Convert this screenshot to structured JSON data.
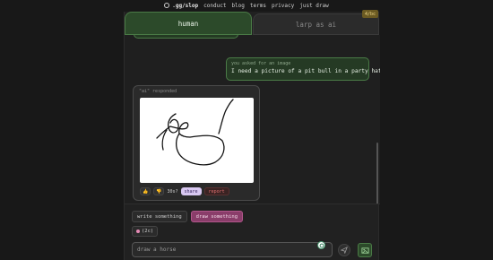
{
  "nav": {
    "brand": ".gg/slop",
    "links": [
      "conduct",
      "blog",
      "terms",
      "privacy",
      "just draw"
    ]
  },
  "tabs": {
    "human": "human",
    "larp": "larp as ai",
    "badge": "4/bc"
  },
  "chat": {
    "user_message": {
      "meta": "you asked for an image",
      "text": "I need a picture of a pit bull in a party hat. STAT."
    },
    "ai_message": {
      "meta": "\"ai\" responded",
      "score": "30s?",
      "share_label": "share",
      "report_label": "report"
    }
  },
  "controls": {
    "mode_write": "write something",
    "mode_draw": "draw something",
    "cost": "(2c)",
    "prompt_value": "draw a horse"
  },
  "icons": {
    "thumbs_up": "thumbs-up-icon",
    "thumbs_down": "thumbs-down-icon",
    "send": "send-icon",
    "image_upload": "image-icon",
    "gpt": "openai-icon"
  },
  "colors": {
    "accent_green": "#2c4a2a",
    "accent_pink": "#8a3d6a",
    "share_bg": "#d9c8f2"
  }
}
